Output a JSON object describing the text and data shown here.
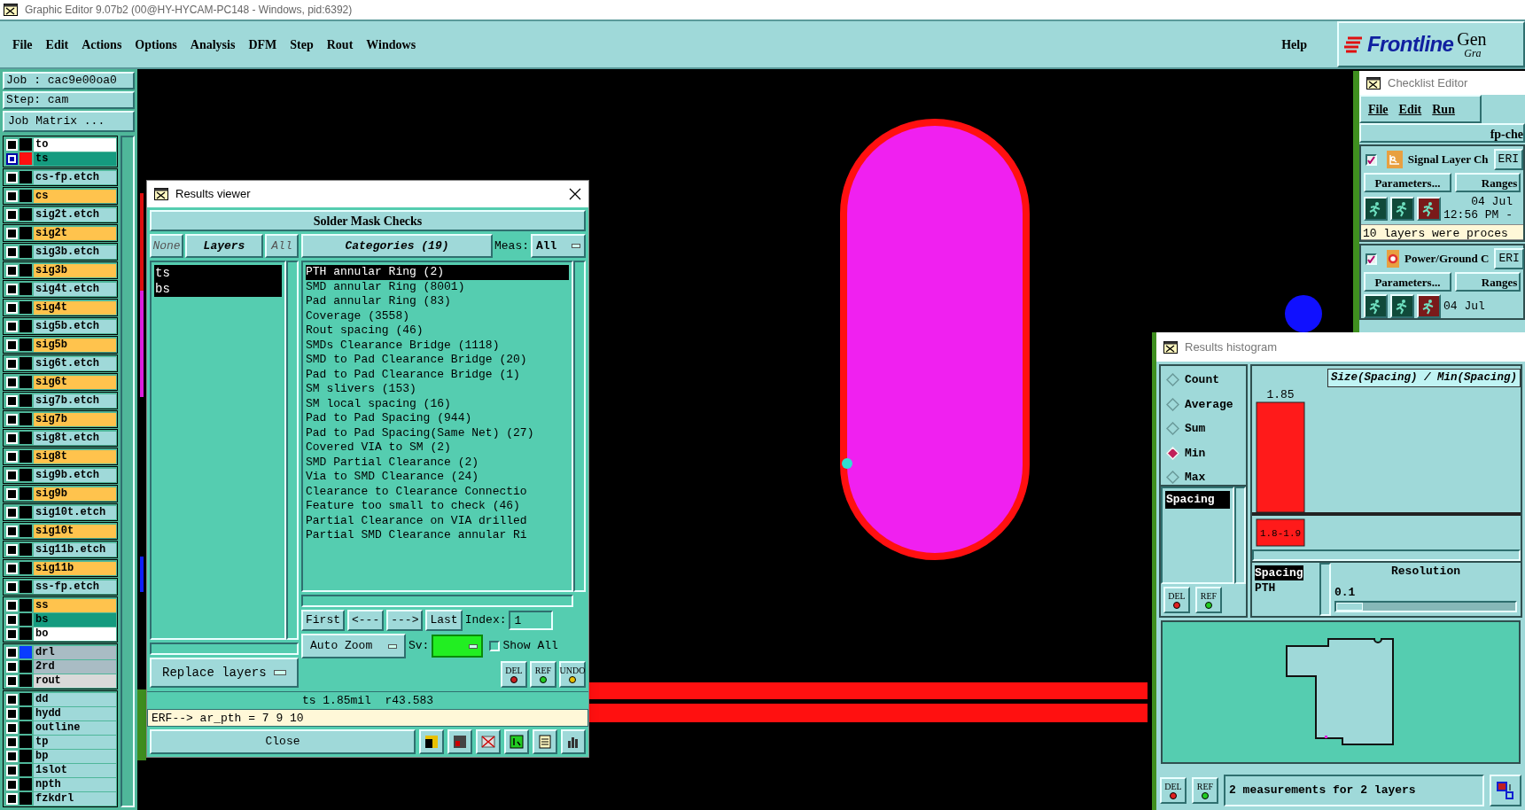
{
  "window": {
    "title": "Graphic Editor 9.07b2 (00@HY-HYCAM-PC148 - Windows, pid:6392)"
  },
  "menu": [
    "File",
    "Edit",
    "Actions",
    "Options",
    "Analysis",
    "DFM",
    "Step",
    "Rout",
    "Windows"
  ],
  "help": "Help",
  "logo": {
    "brand": "Frontline",
    "product": "Gen",
    "subtitle": "Gra"
  },
  "job": {
    "job": "Job : cac9e00oa0",
    "step": "Step: cam",
    "matrix_button": "Job Matrix ..."
  },
  "layer_groups": [
    [
      {
        "name": "to",
        "kind": "silk",
        "selected": false
      },
      {
        "name": "ts",
        "kind": "mask",
        "selected": true,
        "color": "#ff1010"
      }
    ],
    [
      {
        "name": "cs-fp.etch",
        "kind": "misc",
        "selected": false
      }
    ],
    [
      {
        "name": "cs",
        "kind": "signal",
        "selected": false
      }
    ],
    [
      {
        "name": "sig2t.etch",
        "kind": "misc",
        "selected": false
      }
    ],
    [
      {
        "name": "sig2t",
        "kind": "signal",
        "selected": false
      }
    ],
    [
      {
        "name": "sig3b.etch",
        "kind": "misc",
        "selected": false
      }
    ],
    [
      {
        "name": "sig3b",
        "kind": "signal",
        "selected": false
      }
    ],
    [
      {
        "name": "sig4t.etch",
        "kind": "misc",
        "selected": false
      }
    ],
    [
      {
        "name": "sig4t",
        "kind": "signal",
        "selected": false
      }
    ],
    [
      {
        "name": "sig5b.etch",
        "kind": "misc",
        "selected": false
      }
    ],
    [
      {
        "name": "sig5b",
        "kind": "signal",
        "selected": false
      }
    ],
    [
      {
        "name": "sig6t.etch",
        "kind": "misc",
        "selected": false
      }
    ],
    [
      {
        "name": "sig6t",
        "kind": "signal",
        "selected": false
      }
    ],
    [
      {
        "name": "sig7b.etch",
        "kind": "misc",
        "selected": false
      }
    ],
    [
      {
        "name": "sig7b",
        "kind": "signal",
        "selected": false
      }
    ],
    [
      {
        "name": "sig8t.etch",
        "kind": "misc",
        "selected": false
      }
    ],
    [
      {
        "name": "sig8t",
        "kind": "signal",
        "selected": false
      }
    ],
    [
      {
        "name": "sig9b.etch",
        "kind": "misc",
        "selected": false
      }
    ],
    [
      {
        "name": "sig9b",
        "kind": "signal",
        "selected": false
      }
    ],
    [
      {
        "name": "sig10t.etch",
        "kind": "misc",
        "selected": false
      }
    ],
    [
      {
        "name": "sig10t",
        "kind": "signal",
        "selected": false
      }
    ],
    [
      {
        "name": "sig11b.etch",
        "kind": "misc",
        "selected": false
      }
    ],
    [
      {
        "name": "sig11b",
        "kind": "signal",
        "selected": false
      }
    ],
    [
      {
        "name": "ss-fp.etch",
        "kind": "misc",
        "selected": false
      }
    ],
    [
      {
        "name": "ss",
        "kind": "signal",
        "selected": false
      },
      {
        "name": "bs",
        "kind": "mask",
        "selected": false
      },
      {
        "name": "bo",
        "kind": "silk",
        "selected": false
      }
    ],
    [
      {
        "name": "drl",
        "kind": "drill",
        "selected": false,
        "color": "#0a3cff"
      },
      {
        "name": "2rd",
        "kind": "drill",
        "selected": false
      },
      {
        "name": "rout",
        "kind": "rout",
        "selected": false
      }
    ],
    [
      {
        "name": "dd",
        "kind": "misc",
        "selected": false
      },
      {
        "name": "hydd",
        "kind": "misc",
        "selected": false
      },
      {
        "name": "outline",
        "kind": "misc",
        "selected": false
      },
      {
        "name": "tp",
        "kind": "misc",
        "selected": false
      },
      {
        "name": "bp",
        "kind": "misc",
        "selected": false
      },
      {
        "name": "1slot",
        "kind": "misc",
        "selected": false
      },
      {
        "name": "npth",
        "kind": "misc",
        "selected": false
      },
      {
        "name": "fzkdrl",
        "kind": "misc",
        "selected": false
      }
    ]
  ],
  "results_viewer": {
    "title": "Results viewer",
    "header": "Solder Mask Checks",
    "layer_buttons": [
      {
        "label": "None",
        "disabled": true
      },
      {
        "label": "Layers",
        "disabled": false
      },
      {
        "label": "All",
        "disabled": true
      }
    ],
    "layers": [
      {
        "name": "ts",
        "selected": true
      },
      {
        "name": "bs",
        "selected": true
      }
    ],
    "categories_button": "Categories (19)",
    "meas_label": "Meas:",
    "meas_value": "All",
    "categories": [
      {
        "label": "PTH annular Ring (2)",
        "selected": true
      },
      {
        "label": "SMD annular Ring (8001)",
        "selected": false
      },
      {
        "label": "Pad annular Ring (83)",
        "selected": false
      },
      {
        "label": "Coverage (3558)",
        "selected": false
      },
      {
        "label": "Rout spacing (46)",
        "selected": false
      },
      {
        "label": "SMDs Clearance Bridge (1118)",
        "selected": false
      },
      {
        "label": "SMD to Pad Clearance Bridge (20)",
        "selected": false
      },
      {
        "label": "Pad to Pad Clearance Bridge (1)",
        "selected": false
      },
      {
        "label": "SM slivers (153)",
        "selected": false
      },
      {
        "label": "SM local spacing (16)",
        "selected": false
      },
      {
        "label": "Pad to Pad Spacing (944)",
        "selected": false
      },
      {
        "label": "Pad to Pad Spacing(Same Net) (27)",
        "selected": false
      },
      {
        "label": "Covered VIA to SM (2)",
        "selected": false
      },
      {
        "label": "SMD Partial Clearance (2)",
        "selected": false
      },
      {
        "label": "Via to SMD Clearance (24)",
        "selected": false
      },
      {
        "label": "Clearance to Clearance Connectio",
        "selected": false
      },
      {
        "label": "Feature too small to check (46)",
        "selected": false
      },
      {
        "label": "Partial Clearance on VIA drilled",
        "selected": false
      },
      {
        "label": "Partial SMD Clearance annular Ri",
        "selected": false
      }
    ],
    "nav": [
      "First",
      "<---",
      "--->",
      "Last"
    ],
    "index_label": "Index:",
    "index_value": "1",
    "auto_zoom": "Auto Zoom",
    "sv_label": "Sv:",
    "show_all": {
      "label": "Show All",
      "checked": false
    },
    "tool_buttons": [
      "DEL",
      "REF",
      "UNDO"
    ],
    "replace": "Replace layers",
    "status": "ts 1.85mil  r43.583",
    "erf": "ERF--> ar_pth = 7 9 10",
    "close": "Close"
  },
  "checklist": {
    "title": "Checklist Editor",
    "menu": [
      "File",
      "Edit",
      "Run"
    ],
    "header": "fp-che",
    "checks": [
      {
        "name": "Signal Layer Ch",
        "checked": true,
        "erf": "ERI",
        "parameters": "Parameters...",
        "ranges": "Ranges",
        "date": "04 Jul",
        "time": "12:56 PM -",
        "message": "10 layers were proces"
      },
      {
        "name": "Power/Ground C",
        "checked": true,
        "erf": "ERI",
        "parameters": "Parameters...",
        "ranges": "Ranges",
        "date": "04 Jul"
      }
    ]
  },
  "histogram": {
    "title": "Results histogram",
    "modes": [
      {
        "label": "Count",
        "selected": false
      },
      {
        "label": "Average",
        "selected": false
      },
      {
        "label": "Sum",
        "selected": false
      },
      {
        "label": "Min",
        "selected": true
      },
      {
        "label": "Max",
        "selected": false
      }
    ],
    "measures": [
      {
        "label": "Spacing",
        "selected": true
      }
    ],
    "chart_title": "Size(Spacing) / Min(Spacing)",
    "bars": [
      {
        "value_label": "1.85",
        "range_label": "1.8-1.9"
      }
    ],
    "types": [
      {
        "label": "Spacing",
        "selected": true
      },
      {
        "label": "PTH",
        "selected": false
      }
    ],
    "resolution_label": "Resolution",
    "resolution_value": "0.1",
    "resolution": {
      "level": 0
    },
    "tool_buttons": [
      "DEL",
      "REF"
    ],
    "footer_buttons": [
      "DEL",
      "REF"
    ],
    "status": "2 measurements for 2 layers"
  }
}
